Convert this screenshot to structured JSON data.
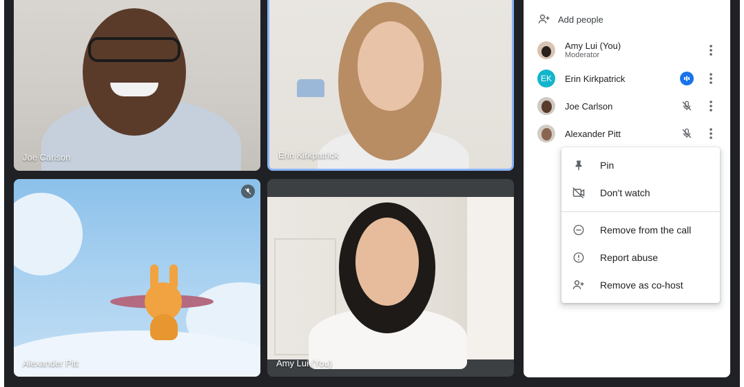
{
  "tiles": [
    {
      "label": "Joe Carlson"
    },
    {
      "label": "Erin Kirkpatrick"
    },
    {
      "label": "Alexander Pitt"
    },
    {
      "label": "Amy Lui (You)"
    }
  ],
  "panel": {
    "add_people": "Add people",
    "participants": [
      {
        "name": "Amy Lui (You)",
        "role": "Moderator",
        "avatar": "photo"
      },
      {
        "name": "Erin Kirkpatrick",
        "initials": "EK",
        "avatar_color": "#12b5cb",
        "status_icon": "speaking-icon"
      },
      {
        "name": "Joe Carlson",
        "avatar": "photo",
        "status_icon": "mic-off-icon"
      },
      {
        "name": "Alexander Pitt",
        "avatar": "photo",
        "status_icon": "mic-off-icon"
      }
    ]
  },
  "menu": {
    "items": [
      {
        "label": "Pin",
        "icon": "pin-icon"
      },
      {
        "label": "Don't watch",
        "icon": "video-off-icon"
      },
      {
        "label": "Remove from the call",
        "icon": "minus-circle-icon"
      },
      {
        "label": "Report abuse",
        "icon": "alert-circle-icon"
      },
      {
        "label": "Remove as co-host",
        "icon": "person-add-icon"
      }
    ]
  },
  "colors": {
    "background": "#202124",
    "accent": "#1a73e8",
    "highlight_border": "#8ab4f8"
  }
}
